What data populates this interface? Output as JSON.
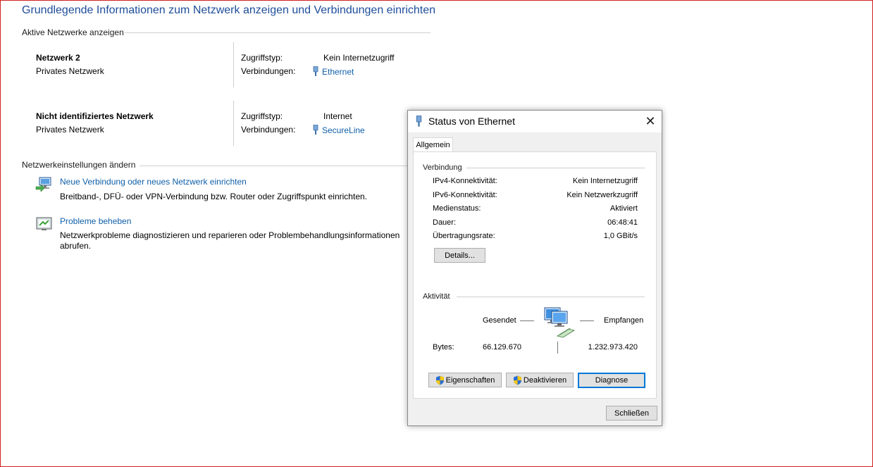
{
  "page": {
    "title": "Grundlegende Informationen zum Netzwerk anzeigen und Verbindungen einrichten",
    "active_networks_label": "Aktive Netzwerke anzeigen",
    "networks": [
      {
        "name": "Netzwerk 2",
        "type": "Privates Netzwerk",
        "access_label": "Zugriffstyp:",
        "access_value": "Kein Internetzugriff",
        "connections_label": "Verbindungen:",
        "connection": "Ethernet"
      },
      {
        "name": "Nicht identifiziertes Netzwerk",
        "type": "Privates Netzwerk",
        "access_label": "Zugriffstyp:",
        "access_value": "Internet",
        "connections_label": "Verbindungen:",
        "connection": "SecureLine"
      }
    ],
    "change_settings_label": "Netzwerkeinstellungen ändern",
    "tasks": [
      {
        "icon": "network-setup-icon",
        "link": "Neue Verbindung oder neues Netzwerk einrichten",
        "description": "Breitband-, DFÜ- oder VPN-Verbindung bzw. Router oder Zugriffspunkt einrichten."
      },
      {
        "icon": "troubleshoot-icon",
        "link": "Probleme beheben",
        "description_line1": "Netzwerkprobleme diagnostizieren und reparieren oder Problembehandlungsinformationen",
        "description_line2": "abrufen."
      }
    ]
  },
  "dialog": {
    "title": "Status von Ethernet",
    "tab": "Allgemein",
    "connection_group": "Verbindung",
    "rows": [
      {
        "label": "IPv4-Konnektivität:",
        "value": "Kein Internetzugriff"
      },
      {
        "label": "IPv6-Konnektivität:",
        "value": "Kein Netzwerkzugriff"
      },
      {
        "label": "Medienstatus:",
        "value": "Aktiviert"
      },
      {
        "label": "Dauer:",
        "value": "06:48:41"
      },
      {
        "label": "Übertragungsrate:",
        "value": "1,0 GBit/s"
      }
    ],
    "details_button": "Details...",
    "activity_group": "Aktivität",
    "sent_label": "Gesendet",
    "received_label": "Empfangen",
    "bytes_label": "Bytes:",
    "bytes_sent": "66.129.670",
    "bytes_received": "1.232.973.420",
    "buttons": {
      "properties": "Eigenschaften",
      "disable": "Deaktivieren",
      "diagnose": "Diagnose"
    },
    "close_button": "Schließen"
  },
  "colors": {
    "link": "#0f5fa8",
    "title": "#1e4d9a",
    "window_border": "#d02020",
    "focus": "#0078d7"
  }
}
